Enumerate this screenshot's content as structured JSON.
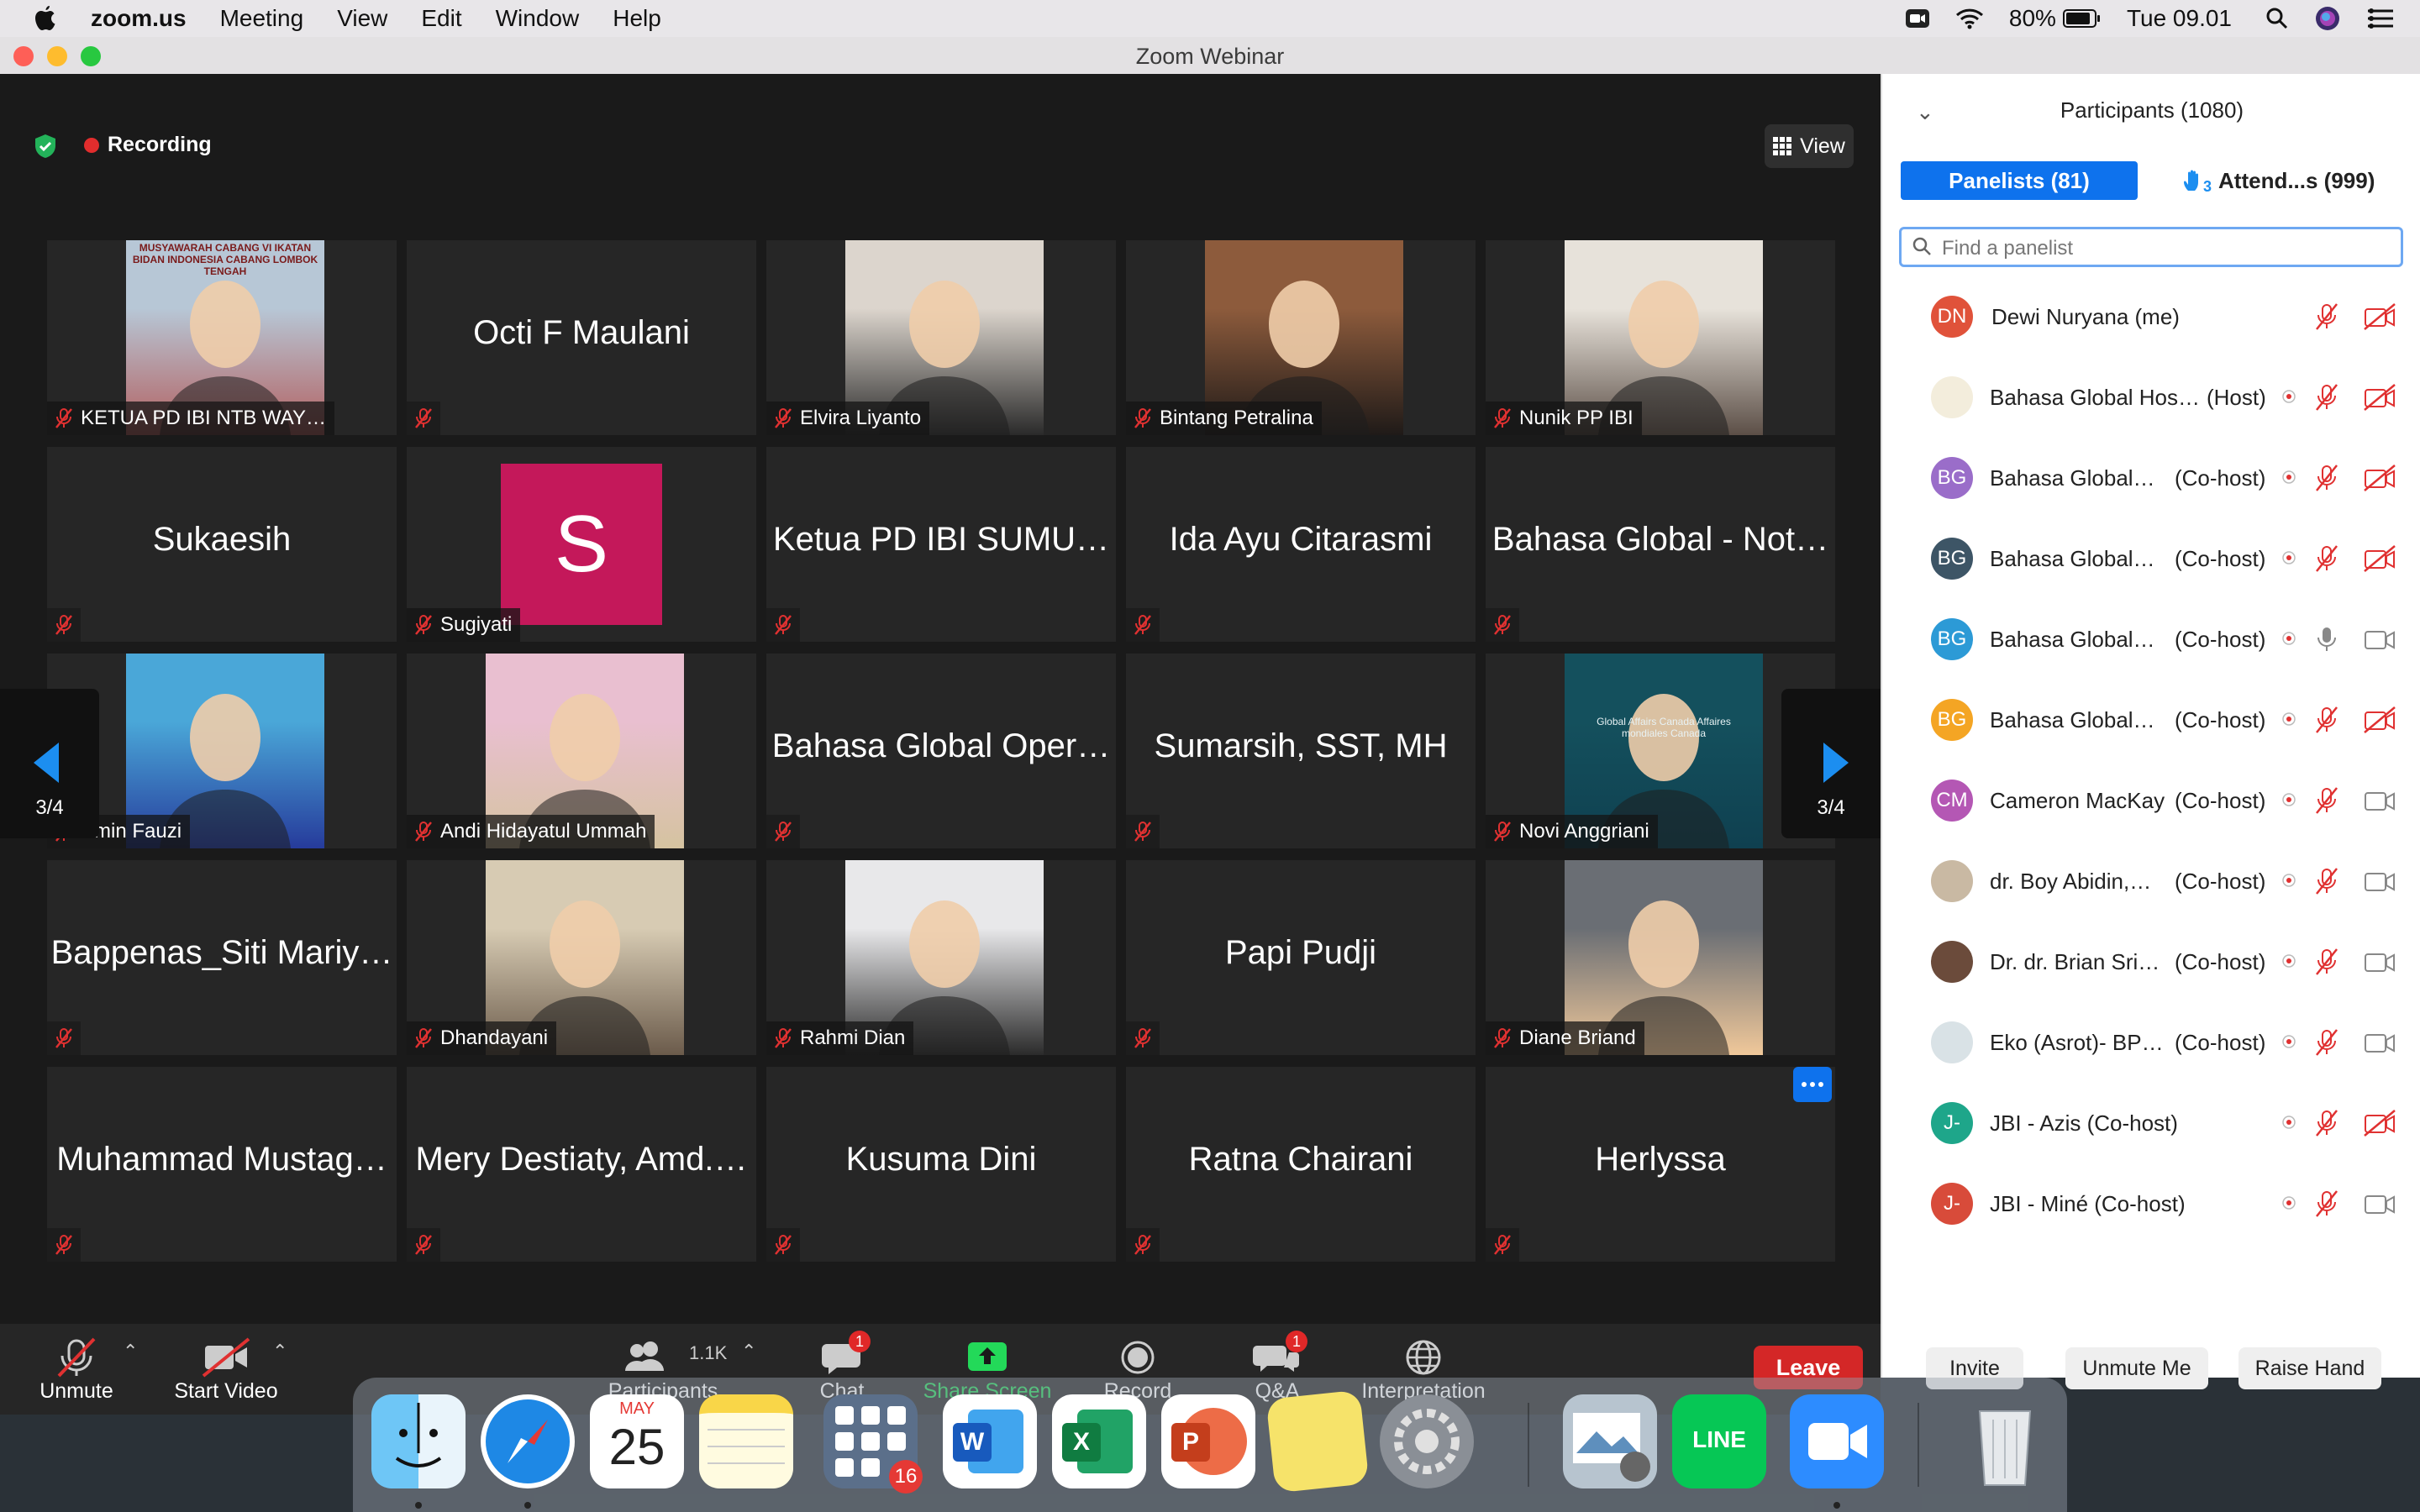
{
  "menubar": {
    "app_name": "zoom.us",
    "items": [
      "Meeting",
      "View",
      "Edit",
      "Window",
      "Help"
    ],
    "battery": "80%",
    "clock": "Tue 09.01"
  },
  "window": {
    "title": "Zoom Webinar"
  },
  "meeting": {
    "recording_label": "Recording",
    "view_label": "View",
    "page_left": "3/4",
    "page_right": "3/4"
  },
  "tiles": [
    {
      "name": "KETUA PD IBI NTB WAY…",
      "type": "video"
    },
    {
      "name": "Octi F Maulani",
      "type": "name"
    },
    {
      "name": "Elvira Liyanto",
      "type": "video"
    },
    {
      "name": "Bintang Petralina",
      "type": "video"
    },
    {
      "name": "Nunik PP IBI",
      "type": "video"
    },
    {
      "name": "Sukaesih",
      "type": "name"
    },
    {
      "name": "Sugiyati",
      "type": "avatar",
      "initial": "S"
    },
    {
      "name": "Ketua PD IBI SUMU…",
      "type": "name"
    },
    {
      "name": "Ida Ayu Citarasmi",
      "type": "name"
    },
    {
      "name": "Bahasa Global - Not…",
      "type": "name"
    },
    {
      "name": "Amin Fauzi",
      "type": "video"
    },
    {
      "name": "Andi Hidayatul Ummah",
      "type": "video"
    },
    {
      "name": "Bahasa Global Oper…",
      "type": "name"
    },
    {
      "name": "Sumarsih, SST, MH",
      "type": "name"
    },
    {
      "name": "Novi Anggriani",
      "type": "video"
    },
    {
      "name": "Bappenas_Siti Mariy…",
      "type": "name"
    },
    {
      "name": "Dhandayani",
      "type": "video"
    },
    {
      "name": "Rahmi Dian",
      "type": "video"
    },
    {
      "name": "Papi Pudji",
      "type": "name"
    },
    {
      "name": "Diane Briand",
      "type": "video"
    },
    {
      "name": "Muhammad Mustag…",
      "type": "name"
    },
    {
      "name": "Mery Destiaty, Amd.…",
      "type": "name"
    },
    {
      "name": "Kusuma Dini",
      "type": "name"
    },
    {
      "name": "Ratna Chairani",
      "type": "name"
    },
    {
      "name": "Herlyssa",
      "type": "name"
    }
  ],
  "thumb_text": {
    "banner": "MUSYAWARAH CABANG VI IKATAN BIDAN INDONESIA CABANG LOMBOK TENGAH",
    "book": "Global Affairs Canada    Affaires mondiales Canada"
  },
  "controls": {
    "unmute": "Unmute",
    "start_video": "Start Video",
    "participants": "Participants",
    "participants_count": "1.1K",
    "chat": "Chat",
    "chat_badge": "1",
    "share_screen": "Share Screen",
    "record": "Record",
    "qa": "Q&A",
    "qa_badge": "1",
    "interpretation": "Interpretation",
    "leave": "Leave"
  },
  "panel": {
    "title": "Participants (1080)",
    "tab_panelists": "Panelists (81)",
    "tab_attendees": "Attend...s (999)",
    "attendees_hand_count": "3",
    "search_placeholder": "Find a panelist",
    "buttons": {
      "invite": "Invite",
      "unmute_me": "Unmute Me",
      "raise_hand": "Raise Hand"
    },
    "rows": [
      {
        "initials": "DN",
        "color": "#e0523a",
        "name": "Dewi Nuryana (me)",
        "role": "",
        "mic": "muted",
        "video": "off"
      },
      {
        "initials": "",
        "color": "#f3eddc",
        "name": "Bahasa Global Hos…",
        "role": "(Host)",
        "mic": "muted",
        "video": "off"
      },
      {
        "initials": "BG",
        "color": "#9a6dc9",
        "name": "Bahasa Global…",
        "role": "(Co-host)",
        "mic": "muted",
        "video": "off"
      },
      {
        "initials": "BG",
        "color": "#3d5566",
        "name": "Bahasa Global…",
        "role": "(Co-host)",
        "mic": "muted",
        "video": "off"
      },
      {
        "initials": "BG",
        "color": "#2c9ad6",
        "name": "Bahasa Global…",
        "role": "(Co-host)",
        "mic": "on",
        "video": "on"
      },
      {
        "initials": "BG",
        "color": "#f4a524",
        "name": "Bahasa Global…",
        "role": "(Co-host)",
        "mic": "muted",
        "video": "off"
      },
      {
        "initials": "CM",
        "color": "#b457b4",
        "name": "Cameron MacKay",
        "role": "(Co-host)",
        "mic": "muted",
        "video": "on"
      },
      {
        "initials": "",
        "color": "#c9b9a3",
        "name": "dr. Boy Abidin,…",
        "role": "(Co-host)",
        "mic": "muted",
        "video": "on"
      },
      {
        "initials": "",
        "color": "#6b4b3b",
        "name": "Dr. dr. Brian Sri…",
        "role": "(Co-host)",
        "mic": "muted",
        "video": "on"
      },
      {
        "initials": "",
        "color": "#d9e2e6",
        "name": "Eko (Asrot)- BP…",
        "role": "(Co-host)",
        "mic": "muted",
        "video": "on"
      },
      {
        "initials": "J-",
        "color": "#1ea68a",
        "name": "JBI - Azis (Co-host)",
        "role": "",
        "mic": "muted",
        "video": "off"
      },
      {
        "initials": "J-",
        "color": "#d84b3a",
        "name": "JBI - Miné (Co-host)",
        "role": "",
        "mic": "muted",
        "video": "on"
      }
    ]
  },
  "dock": {
    "calendar_month": "MAY",
    "calendar_day": "25",
    "launchpad_badge": "16",
    "line_label": "LINE"
  },
  "colors": {
    "accent": "#0e72ed",
    "share_green": "#23d959",
    "leave_red": "#d42727",
    "mute_red": "#e03131"
  }
}
